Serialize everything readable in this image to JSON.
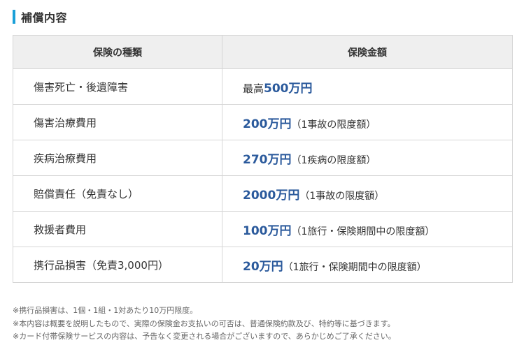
{
  "section": {
    "title": "補償内容"
  },
  "table": {
    "headers": {
      "type": "保険の種類",
      "amount": "保険金額"
    },
    "rows": [
      {
        "type": "傷害死亡・後遺障害",
        "prefix": "最高",
        "amount": "500万円",
        "note": ""
      },
      {
        "type": "傷害治療費用",
        "prefix": "",
        "amount": "200万円",
        "note": "（1事故の限度額）"
      },
      {
        "type": "疾病治療費用",
        "prefix": "",
        "amount": "270万円",
        "note": "（1疾病の限度額）"
      },
      {
        "type": "賠償責任（免責なし）",
        "prefix": "",
        "amount": "2000万円",
        "note": "（1事故の限度額）"
      },
      {
        "type": "救援者費用",
        "prefix": "",
        "amount": "100万円",
        "note": "（1旅行・保険期間中の限度額）"
      },
      {
        "type": "携行品損害（免責3,000円）",
        "prefix": "",
        "amount": "20万円",
        "note": "（1旅行・保険期間中の限度額）"
      }
    ]
  },
  "footnotes": [
    "※携行品損害は、1個・1組・1対あたり10万円限度。",
    "※本内容は概要を説明したもので、実際の保険金お支払いの可否は、普通保険約款及び、特約等に基づきます。",
    "※カード付帯保険サービスの内容は、予告なく変更される場合がございますので、あらかじめご了承ください。"
  ],
  "colors": {
    "accent_bar": "#1aa0d8",
    "amount_text": "#2b5a9c",
    "header_bg": "#efefef",
    "border": "#d6d6d6"
  }
}
